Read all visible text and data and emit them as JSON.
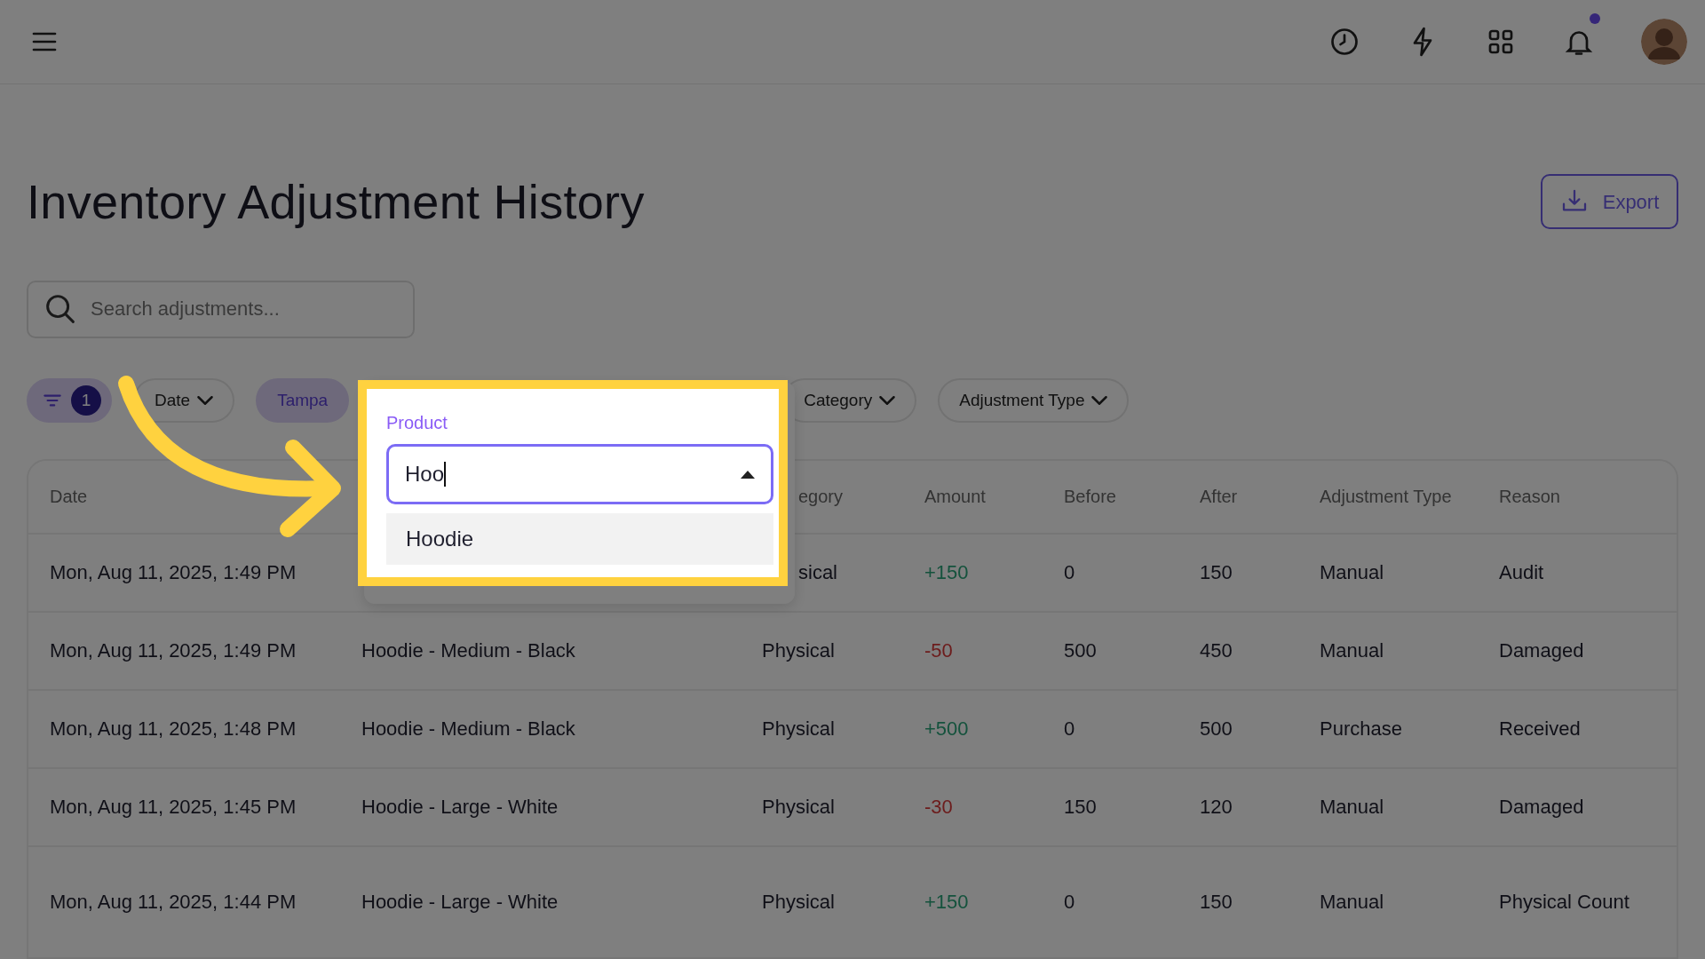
{
  "topbar": {
    "notifications": {
      "unread": true
    }
  },
  "title": "Inventory Adjustment History",
  "export_button": "Export",
  "search": {
    "placeholder": "Search adjustments..."
  },
  "filters": [
    {
      "kind": "count",
      "label": "1",
      "selected": true
    },
    {
      "kind": "dropdown",
      "label": "Date",
      "selected": false
    },
    {
      "kind": "chip",
      "label": "Tampa",
      "selected": true
    },
    {
      "kind": "dropdown",
      "label": "Category",
      "selected": false
    },
    {
      "kind": "dropdown",
      "label": "Adjustment Type",
      "selected": false
    }
  ],
  "table": {
    "columns": [
      {
        "label": "Date"
      },
      {},
      {
        "label": "egory",
        "cut": true
      },
      {
        "label": "Amount"
      },
      {
        "label": "Before"
      },
      {
        "label": "After"
      },
      {
        "label": "Adjustment Type"
      },
      {
        "label": "Reason"
      }
    ],
    "rows": [
      {
        "date": "Mon, Aug 11, 2025, 1:49 PM",
        "category": "sical",
        "category_cut": true,
        "amount": {
          "text": "+150",
          "kind": "increase"
        },
        "before": "0",
        "after": "150",
        "adjustment_type": "Manual",
        "reason": "Audit"
      },
      {
        "date": "Mon, Aug 11, 2025, 1:49 PM",
        "product": "Hoodie - Medium - Black",
        "category": "Physical",
        "amount": {
          "text": "-50",
          "kind": "decrease"
        },
        "before": "500",
        "after": "450",
        "adjustment_type": "Manual",
        "reason": "Damaged"
      },
      {
        "date": "Mon, Aug 11, 2025, 1:48 PM",
        "product": "Hoodie - Medium - Black",
        "category": "Physical",
        "amount": {
          "text": "+500",
          "kind": "increase"
        },
        "before": "0",
        "after": "500",
        "adjustment_type": "Purchase",
        "reason": "Received"
      },
      {
        "date": "Mon, Aug 11, 2025, 1:45 PM",
        "product": "Hoodie - Large - White",
        "category": "Physical",
        "amount": {
          "text": "-30",
          "kind": "decrease"
        },
        "before": "150",
        "after": "120",
        "adjustment_type": "Manual",
        "reason": "Damaged"
      },
      {
        "date": "Mon, Aug 11, 2025, 1:44 PM",
        "product": "Hoodie - Large - White",
        "category": "Physical",
        "amount": {
          "text": "+150",
          "kind": "increase"
        },
        "before": "0",
        "after": "150",
        "adjustment_type": "Manual",
        "reason": "Physical Count"
      }
    ]
  },
  "product_filter": {
    "label": "Product",
    "value": "Hoo",
    "expanded": true,
    "options": [
      {
        "label": "Hoodie",
        "selected": true
      }
    ]
  }
}
